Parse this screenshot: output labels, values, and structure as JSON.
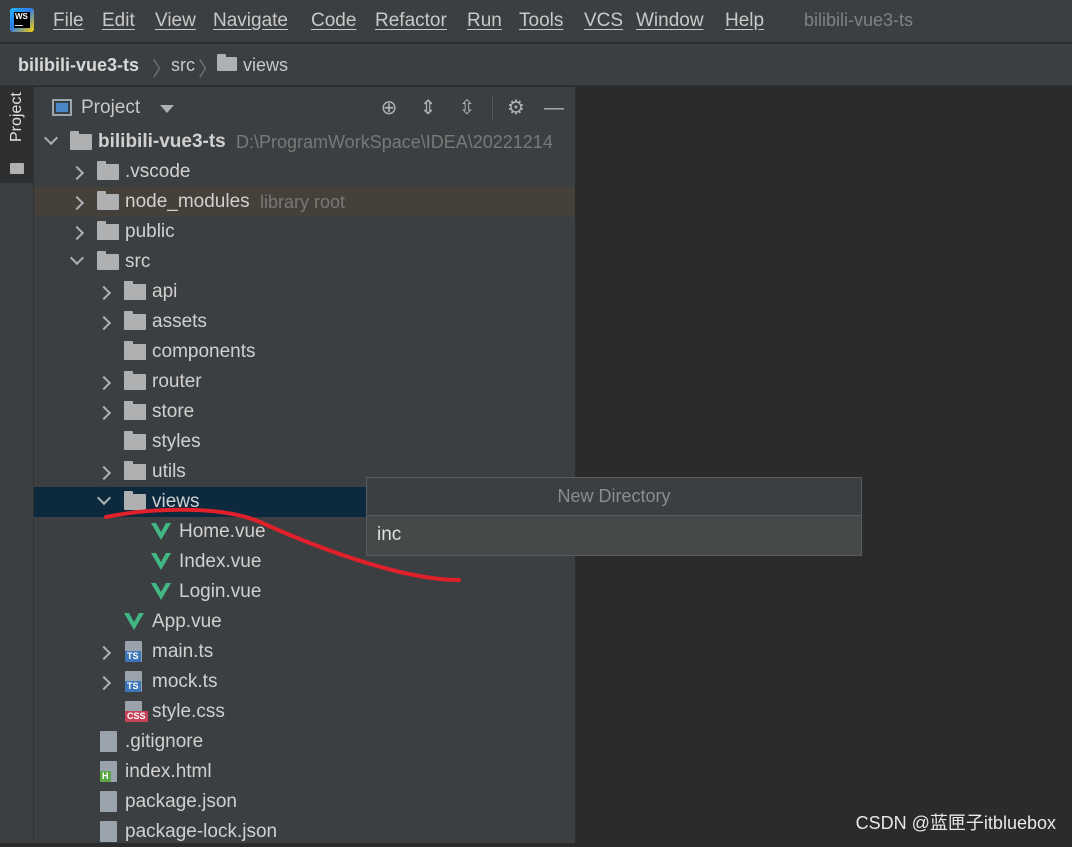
{
  "menubar": {
    "items": [
      "File",
      "Edit",
      "View",
      "Navigate",
      "Code",
      "Refactor",
      "Run",
      "Tools",
      "VCS",
      "Window",
      "Help"
    ],
    "window_title": "bilibili-vue3-ts"
  },
  "breadcrumb": {
    "project": "bilibili-vue3-ts",
    "folder1": "src",
    "folder2": "views"
  },
  "side_stripe": {
    "label": "Project"
  },
  "panel": {
    "title": "Project",
    "tree": {
      "root_name": "bilibili-vue3-ts",
      "root_path": "D:\\ProgramWorkSpace\\IDEA\\20221214",
      "vscode": ".vscode",
      "node_modules": "node_modules",
      "node_modules_hint": "library root",
      "public": "public",
      "src": "src",
      "api": "api",
      "assets": "assets",
      "components": "components",
      "router": "router",
      "store": "store",
      "styles": "styles",
      "utils": "utils",
      "views": "views",
      "home": "Home.vue",
      "index": "Index.vue",
      "login": "Login.vue",
      "app": "App.vue",
      "main": "main.ts",
      "mock": "mock.ts",
      "style": "style.css",
      "gitignore": ".gitignore",
      "indexhtml": "index.html",
      "package": "package.json",
      "packagelock": "package-lock.json"
    }
  },
  "badges": {
    "ts": "TS",
    "css": "CSS",
    "h": "H"
  },
  "dialog": {
    "title": "New Directory",
    "value": "inc"
  },
  "watermark": "CSDN @蓝匣子itbluebox",
  "colors": {
    "vue": "#41b883",
    "selection": "#0d293e",
    "annotation": "#e0202a"
  }
}
